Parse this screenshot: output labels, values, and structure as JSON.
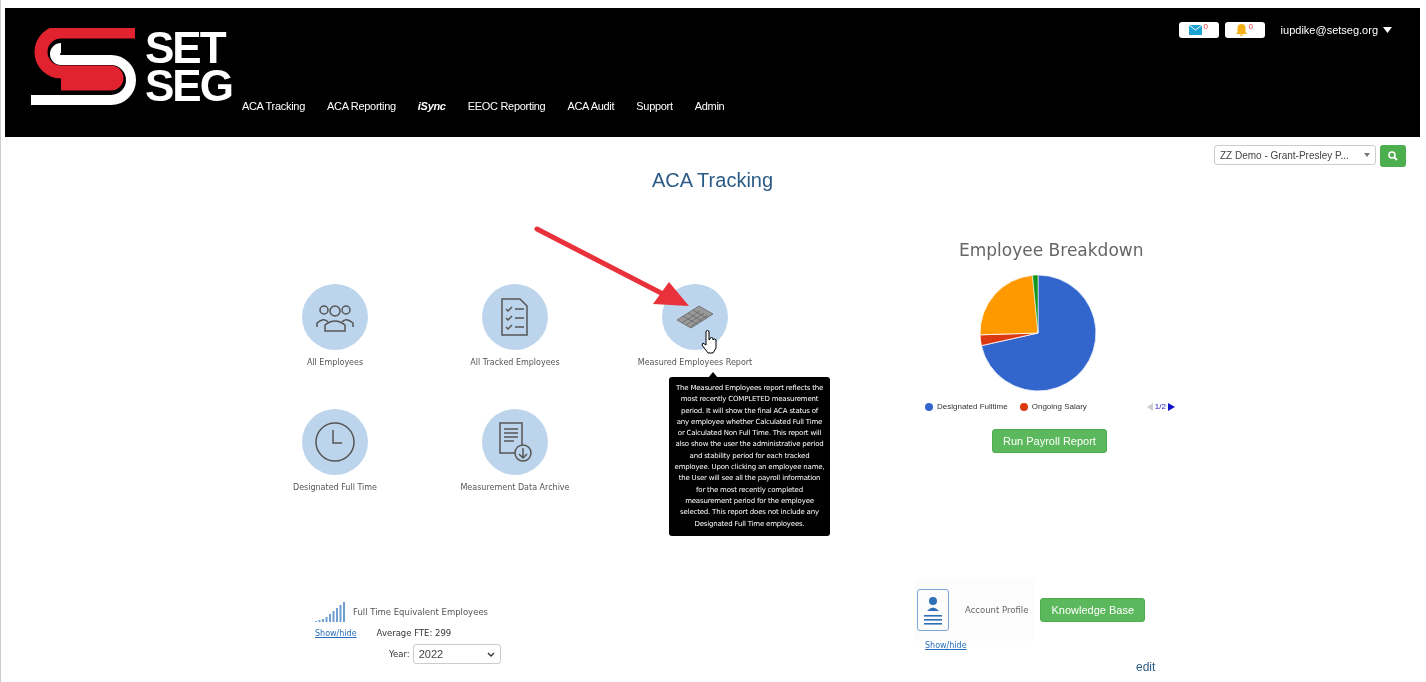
{
  "header": {
    "logo": [
      "SET",
      "SEG"
    ],
    "nav": [
      {
        "label": "ACA Tracking",
        "italic": false
      },
      {
        "label": "ACA Reporting",
        "italic": false
      },
      {
        "label": "iSync",
        "italic": true
      },
      {
        "label": "EEOC Reporting",
        "italic": false
      },
      {
        "label": "ACA Audit",
        "italic": false
      },
      {
        "label": "Support",
        "italic": false
      },
      {
        "label": "Admin",
        "italic": false
      }
    ],
    "messages": "0",
    "alerts": "0",
    "user": "iupdike@setseg.org"
  },
  "company_select": {
    "value": "ZZ Demo - Grant-Presley P..."
  },
  "title": "ACA Tracking",
  "tiles": [
    {
      "label": "All Employees",
      "kind": "people"
    },
    {
      "label": "All Tracked Employees",
      "kind": "checklist"
    },
    {
      "label": "Measured Employees Report",
      "kind": "calculator"
    },
    {
      "label": "Designated Full Time",
      "kind": "clock"
    },
    {
      "label": "Measurement Data Archive",
      "kind": "archive"
    }
  ],
  "tooltip": "The Measured Employees report reflects the most recently COMPLETED measurement period. It will show the final ACA status of any employee whether Calculated Full Time or Calculated Non Full Time. This report will also show the user the administrative period and stability period for each tracked employee. Upon clicking an employee name, the User will see all the payroll information for the most recently completed measurement period for the employee selected. This report does not include any Designated Full Time employees.",
  "breakdown": {
    "title": "Employee Breakdown",
    "legend": [
      {
        "label": "Designated Fulltime",
        "color": "#3366cc"
      },
      {
        "label": "Ongoing Salary",
        "color": "#dc3912"
      }
    ],
    "page": "1/2",
    "button": "Run Payroll Report"
  },
  "fte": {
    "title": "Full Time Equivalent Employees",
    "toggle": "Show/hide",
    "average": "Average FTE: 299",
    "year_label": "Year:",
    "year": "2022"
  },
  "account": {
    "title": "Account Profile",
    "button": "Knowledge Base",
    "toggle": "Show/hide",
    "edit": "edit"
  }
}
